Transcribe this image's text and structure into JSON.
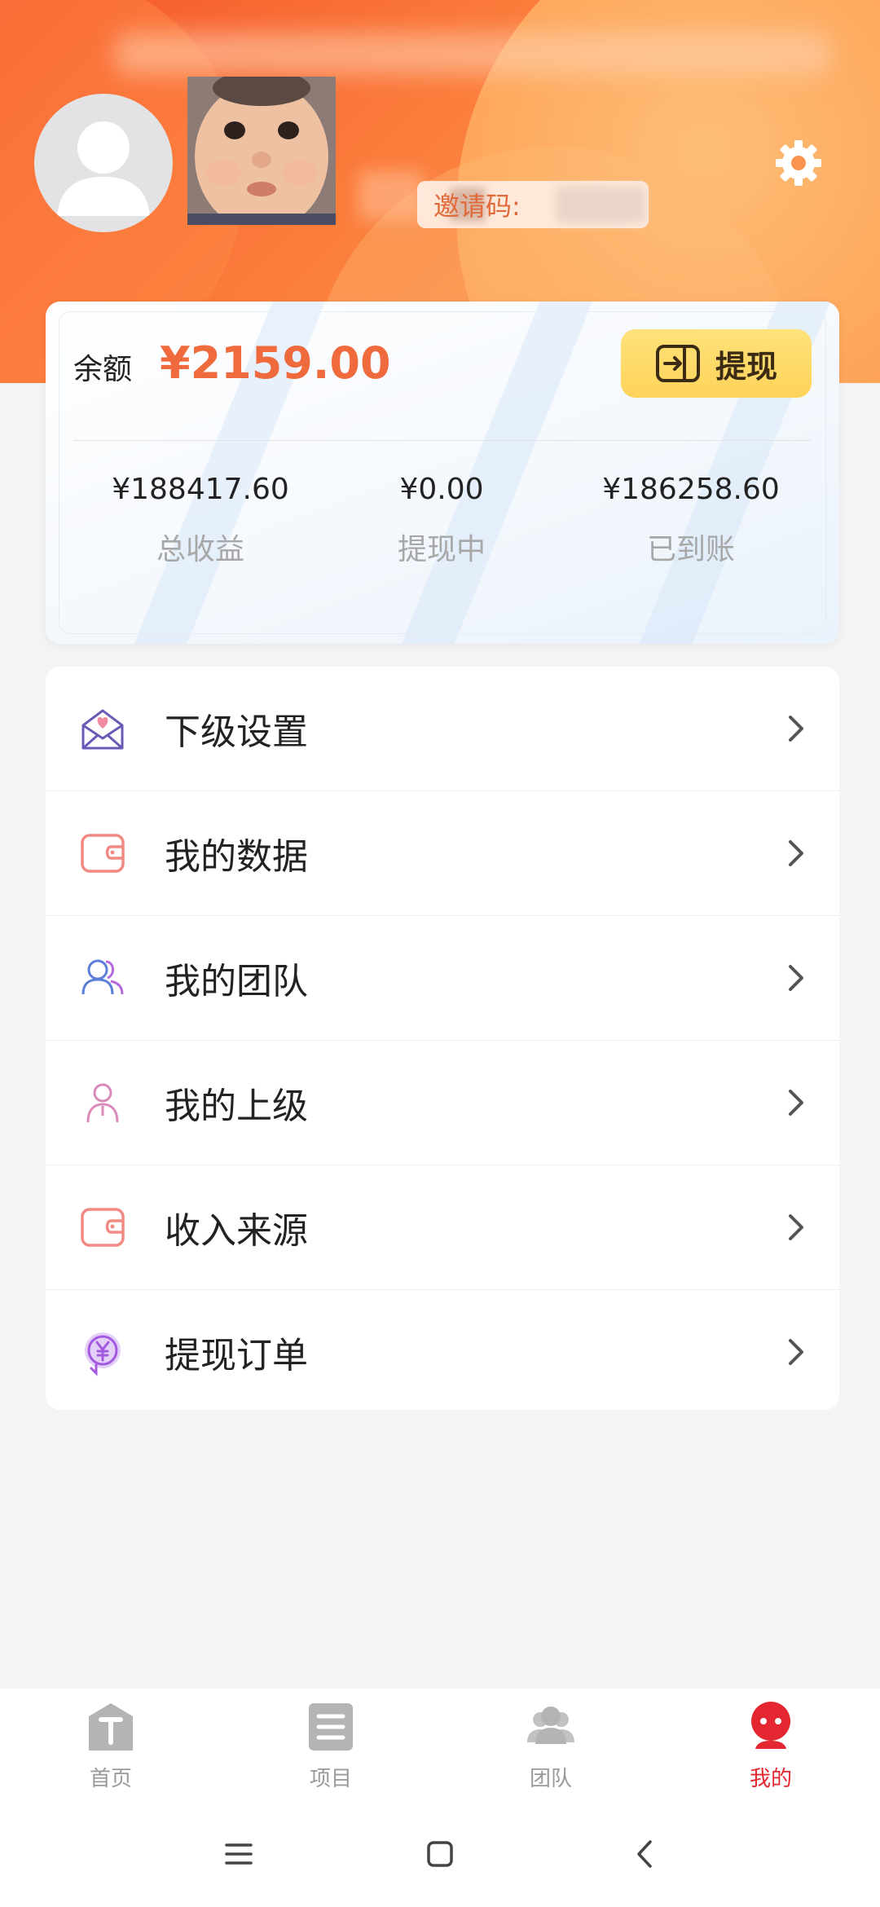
{
  "header": {
    "invite_code_label": "邀请码:"
  },
  "balance_card": {
    "balance_label": "余额",
    "balance_value": "¥2159.00",
    "withdraw_button_label": "提现",
    "stats": [
      {
        "value": "¥188417.60",
        "label": "总收益"
      },
      {
        "value": "¥0.00",
        "label": "提现中"
      },
      {
        "value": "¥186258.60",
        "label": "已到账"
      }
    ]
  },
  "menu": {
    "items": [
      {
        "label": "下级设置",
        "icon": "envelope-heart-icon"
      },
      {
        "label": "我的数据",
        "icon": "wallet-icon"
      },
      {
        "label": "我的团队",
        "icon": "team-icon"
      },
      {
        "label": "我的上级",
        "icon": "person-icon"
      },
      {
        "label": "收入来源",
        "icon": "wallet-icon"
      },
      {
        "label": "提现订单",
        "icon": "yuan-coin-icon"
      }
    ]
  },
  "tabbar": {
    "items": [
      {
        "label": "首页",
        "icon": "home-t-icon",
        "active": false
      },
      {
        "label": "项目",
        "icon": "list-icon",
        "active": false
      },
      {
        "label": "团队",
        "icon": "team-icon",
        "active": false
      },
      {
        "label": "我的",
        "icon": "profile-icon",
        "active": true
      }
    ]
  },
  "colors": {
    "accent_orange": "#ef6a3d",
    "active_tab_red": "#e3262f",
    "withdraw_yellow": "#fdd35a"
  }
}
